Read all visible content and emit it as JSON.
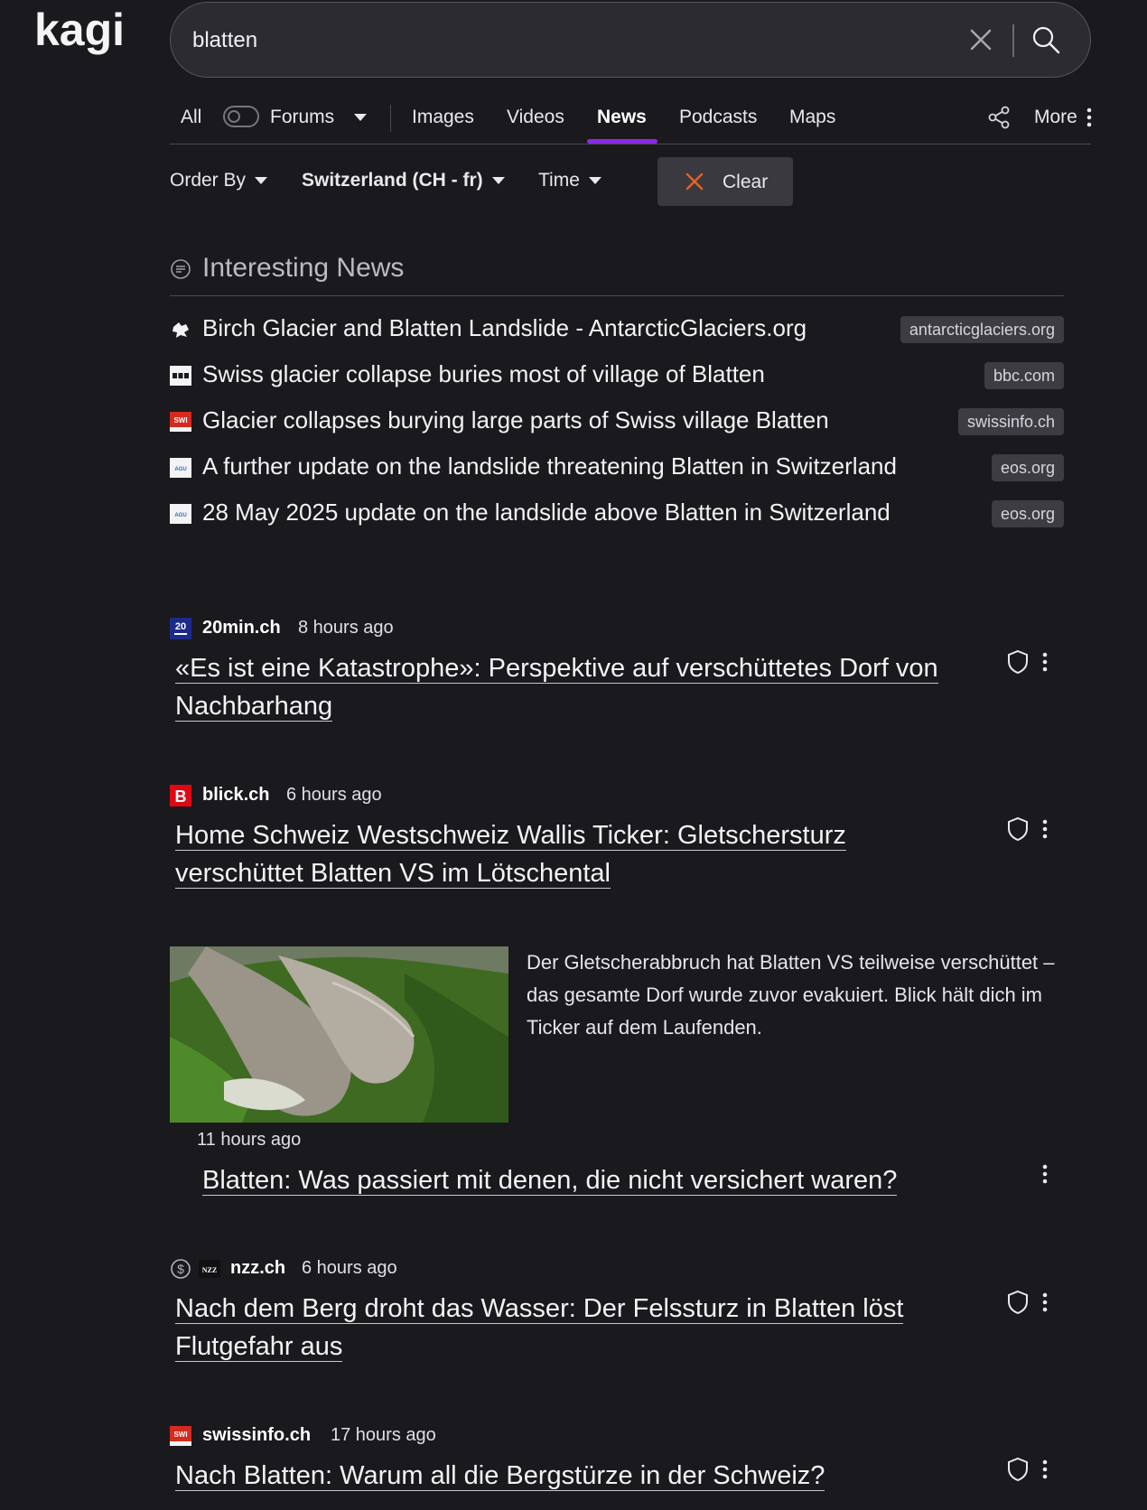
{
  "brand": {
    "logo_text": "kagi"
  },
  "search": {
    "query": "blatten"
  },
  "nav": {
    "items": [
      "All",
      "Forums",
      "Images",
      "Videos",
      "News",
      "Podcasts",
      "Maps",
      "More"
    ],
    "active": "News"
  },
  "filters": {
    "order_by": "Order By",
    "region": "Switzerland (CH - fr)",
    "time": "Time",
    "clear": "Clear"
  },
  "interesting": {
    "title": "Interesting News",
    "items": [
      {
        "title": "Birch Glacier and Blatten Landslide - AntarcticGlaciers.org",
        "domain": "antarcticglaciers.org",
        "icon": "antarcticglaciers-favicon"
      },
      {
        "title": "Swiss glacier collapse buries most of village of Blatten",
        "domain": "bbc.com",
        "icon": "bbc-favicon"
      },
      {
        "title": "Glacier collapses burying large parts of Swiss village Blatten",
        "domain": "swissinfo.ch",
        "icon": "swi-favicon"
      },
      {
        "title": "A further update on the landslide threatening Blatten in Switzerland",
        "domain": "eos.org",
        "icon": "agu-favicon"
      },
      {
        "title": "28 May 2025 update on the landslide above Blatten in Switzerland",
        "domain": "eos.org",
        "icon": "agu-favicon"
      }
    ]
  },
  "results": [
    {
      "source": "20min.ch",
      "time": "8 hours ago",
      "title": "«Es ist eine Katastrophe»: Perspektive auf verschüttetes Dorf von Nachbarhang",
      "icon": "20min-favicon"
    },
    {
      "source": "blick.ch",
      "time": "6 hours ago",
      "title": "Home Schweiz Westschweiz Wallis Ticker: Gletschersturz verschüttet Blatten VS im Lötschental",
      "snippet": "Der Gletscherabbruch hat Blatten VS teilweise verschüttet – das gesamte Dorf wurde zuvor evakuiert. Blick hält dich im Ticker auf dem Laufenden.",
      "icon": "blick-favicon"
    },
    {
      "source": "",
      "time": "11 hours ago",
      "title": "Blatten: Was passiert mit denen, die nicht versichert waren?"
    },
    {
      "source": "nzz.ch",
      "time": "6 hours ago",
      "title": "Nach dem Berg droht das Wasser: Der Felssturz in Blatten löst Flutgefahr aus",
      "icon": "nzz-favicon",
      "paywall_icon": "dollar-icon"
    },
    {
      "source": "swissinfo.ch",
      "time": "17 hours ago",
      "title": "Nach Blatten: Warum all die Bergstürze in der Schweiz?",
      "icon": "swi-favicon"
    }
  ],
  "colors": {
    "background": "#1a191e",
    "accent": "#8a2be2",
    "clear_icon": "#e0642a"
  }
}
